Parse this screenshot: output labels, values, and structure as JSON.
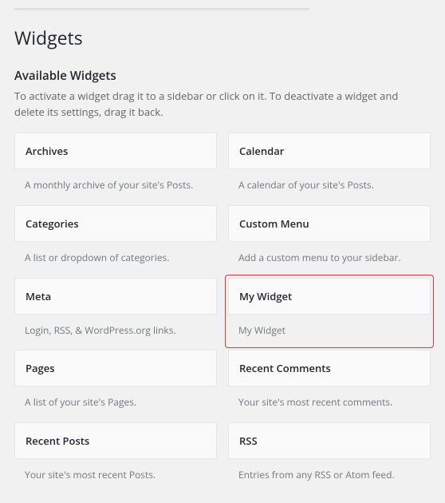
{
  "page": {
    "title": "Widgets"
  },
  "section": {
    "title": "Available Widgets",
    "description": "To activate a widget drag it to a sidebar or click on it. To deactivate a widget and delete its settings, drag it back."
  },
  "widgets": [
    {
      "name": "Archives",
      "desc": "A monthly archive of your site's Posts.",
      "highlight": false
    },
    {
      "name": "Calendar",
      "desc": "A calendar of your site's Posts.",
      "highlight": false
    },
    {
      "name": "Categories",
      "desc": "A list or dropdown of categories.",
      "highlight": false
    },
    {
      "name": "Custom Menu",
      "desc": "Add a custom menu to your sidebar.",
      "highlight": false
    },
    {
      "name": "Meta",
      "desc": "Login, RSS, & WordPress.org links.",
      "highlight": false
    },
    {
      "name": "My Widget",
      "desc": "My Widget",
      "highlight": true
    },
    {
      "name": "Pages",
      "desc": "A list of your site's Pages.",
      "highlight": false
    },
    {
      "name": "Recent Comments",
      "desc": "Your site's most recent comments.",
      "highlight": false
    },
    {
      "name": "Recent Posts",
      "desc": "Your site's most recent Posts.",
      "highlight": false
    },
    {
      "name": "RSS",
      "desc": "Entries from any RSS or Atom feed.",
      "highlight": false
    }
  ]
}
